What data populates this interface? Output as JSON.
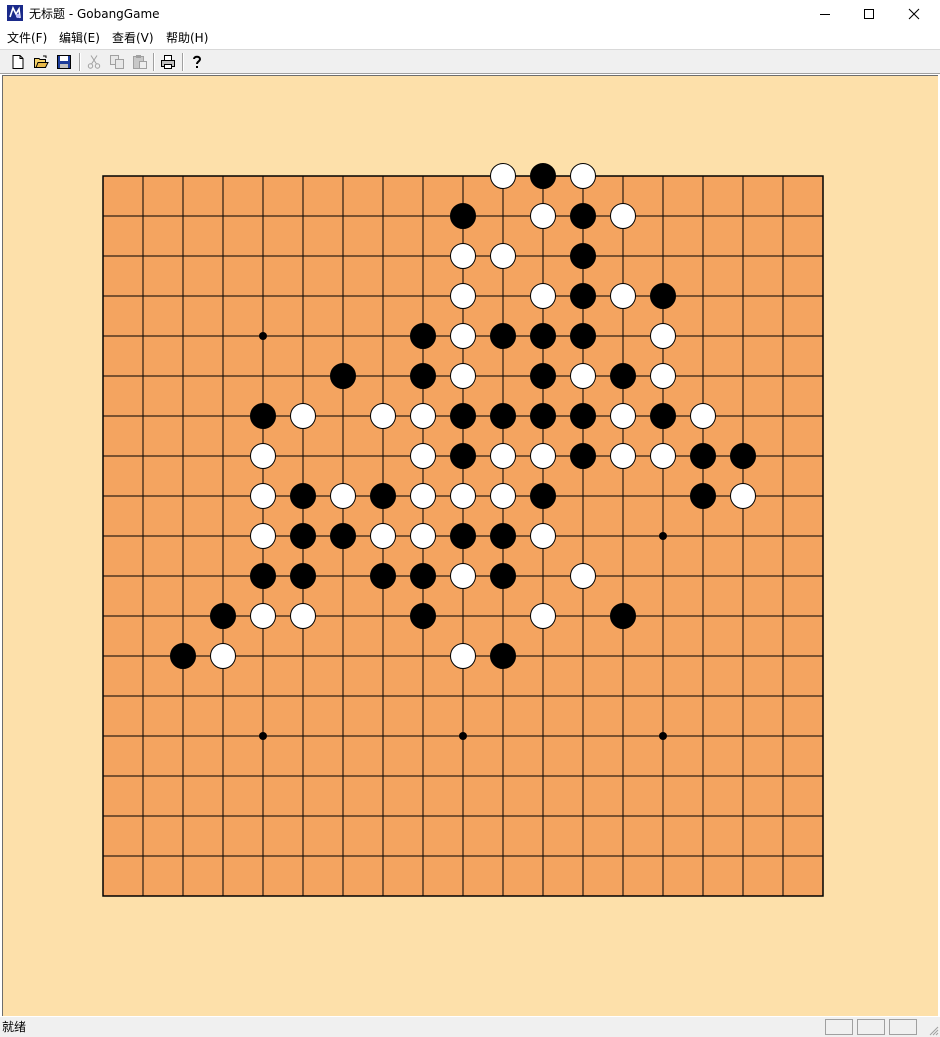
{
  "window": {
    "title": "无标题 - GobangGame",
    "controls": [
      "minimize",
      "maximize",
      "close"
    ]
  },
  "menu": [
    {
      "label": "文件(F)"
    },
    {
      "label": "编辑(E)"
    },
    {
      "label": "查看(V)"
    },
    {
      "label": "帮助(H)"
    }
  ],
  "toolbar": {
    "buttons": [
      {
        "name": "new",
        "icon": "new-document-icon",
        "enabled": true
      },
      {
        "name": "open",
        "icon": "open-folder-icon",
        "enabled": true
      },
      {
        "name": "save",
        "icon": "save-disk-icon",
        "enabled": true
      },
      {
        "name": "cut",
        "icon": "scissors-icon",
        "enabled": false
      },
      {
        "name": "copy",
        "icon": "copy-icon",
        "enabled": false
      },
      {
        "name": "paste",
        "icon": "paste-icon",
        "enabled": false
      },
      {
        "name": "print",
        "icon": "printer-icon",
        "enabled": true
      },
      {
        "name": "about",
        "icon": "help-icon",
        "enabled": true
      }
    ]
  },
  "board": {
    "lines": 19,
    "colors": {
      "background": "#fde0aa",
      "board": "#f4a460",
      "line": "#000000",
      "black_stone": "#000000",
      "white_stone": "#ffffff"
    },
    "star_points": [
      [
        4,
        4
      ],
      [
        4,
        14
      ],
      [
        9,
        14
      ],
      [
        14,
        9
      ],
      [
        14,
        14
      ]
    ],
    "stones": {
      "black": [
        [
          11,
          0
        ],
        [
          9,
          1
        ],
        [
          12,
          1
        ],
        [
          12,
          2
        ],
        [
          12,
          3
        ],
        [
          14,
          3
        ],
        [
          8,
          4
        ],
        [
          10,
          4
        ],
        [
          11,
          4
        ],
        [
          12,
          4
        ],
        [
          6,
          5
        ],
        [
          8,
          5
        ],
        [
          11,
          5
        ],
        [
          13,
          5
        ],
        [
          4,
          6
        ],
        [
          9,
          6
        ],
        [
          10,
          6
        ],
        [
          11,
          6
        ],
        [
          12,
          6
        ],
        [
          14,
          6
        ],
        [
          9,
          7
        ],
        [
          12,
          7
        ],
        [
          15,
          7
        ],
        [
          16,
          7
        ],
        [
          5,
          8
        ],
        [
          7,
          8
        ],
        [
          11,
          8
        ],
        [
          15,
          8
        ],
        [
          5,
          9
        ],
        [
          6,
          9
        ],
        [
          9,
          9
        ],
        [
          10,
          9
        ],
        [
          4,
          10
        ],
        [
          5,
          10
        ],
        [
          7,
          10
        ],
        [
          8,
          10
        ],
        [
          10,
          10
        ],
        [
          3,
          11
        ],
        [
          8,
          11
        ],
        [
          13,
          11
        ],
        [
          2,
          12
        ],
        [
          10,
          12
        ]
      ],
      "white": [
        [
          10,
          0
        ],
        [
          12,
          0
        ],
        [
          11,
          1
        ],
        [
          13,
          1
        ],
        [
          9,
          2
        ],
        [
          10,
          2
        ],
        [
          9,
          3
        ],
        [
          11,
          3
        ],
        [
          13,
          3
        ],
        [
          9,
          4
        ],
        [
          14,
          4
        ],
        [
          9,
          5
        ],
        [
          12,
          5
        ],
        [
          14,
          5
        ],
        [
          5,
          6
        ],
        [
          7,
          6
        ],
        [
          8,
          6
        ],
        [
          13,
          6
        ],
        [
          15,
          6
        ],
        [
          4,
          7
        ],
        [
          8,
          7
        ],
        [
          10,
          7
        ],
        [
          11,
          7
        ],
        [
          13,
          7
        ],
        [
          14,
          7
        ],
        [
          4,
          8
        ],
        [
          6,
          8
        ],
        [
          8,
          8
        ],
        [
          9,
          8
        ],
        [
          10,
          8
        ],
        [
          16,
          8
        ],
        [
          4,
          9
        ],
        [
          7,
          9
        ],
        [
          8,
          9
        ],
        [
          11,
          9
        ],
        [
          9,
          10
        ],
        [
          12,
          10
        ],
        [
          4,
          11
        ],
        [
          5,
          11
        ],
        [
          11,
          11
        ],
        [
          3,
          12
        ],
        [
          9,
          12
        ]
      ]
    }
  },
  "status": {
    "text": "就绪",
    "panes": [
      "",
      "",
      ""
    ]
  }
}
